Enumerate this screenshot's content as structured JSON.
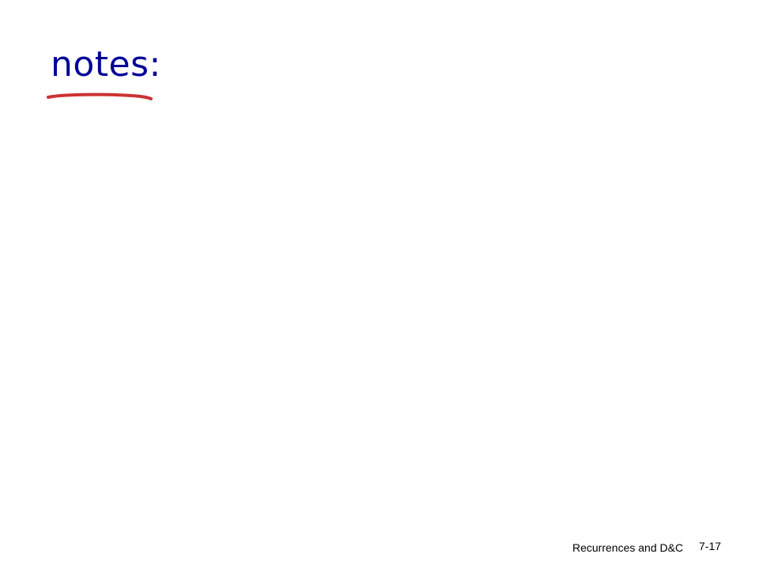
{
  "slide": {
    "title": "notes:",
    "footer": "Recurrences and D&C",
    "slide_number": "7-17"
  },
  "colors": {
    "title": "#000099",
    "underline": "#cc3333",
    "background": "#ffffff"
  }
}
